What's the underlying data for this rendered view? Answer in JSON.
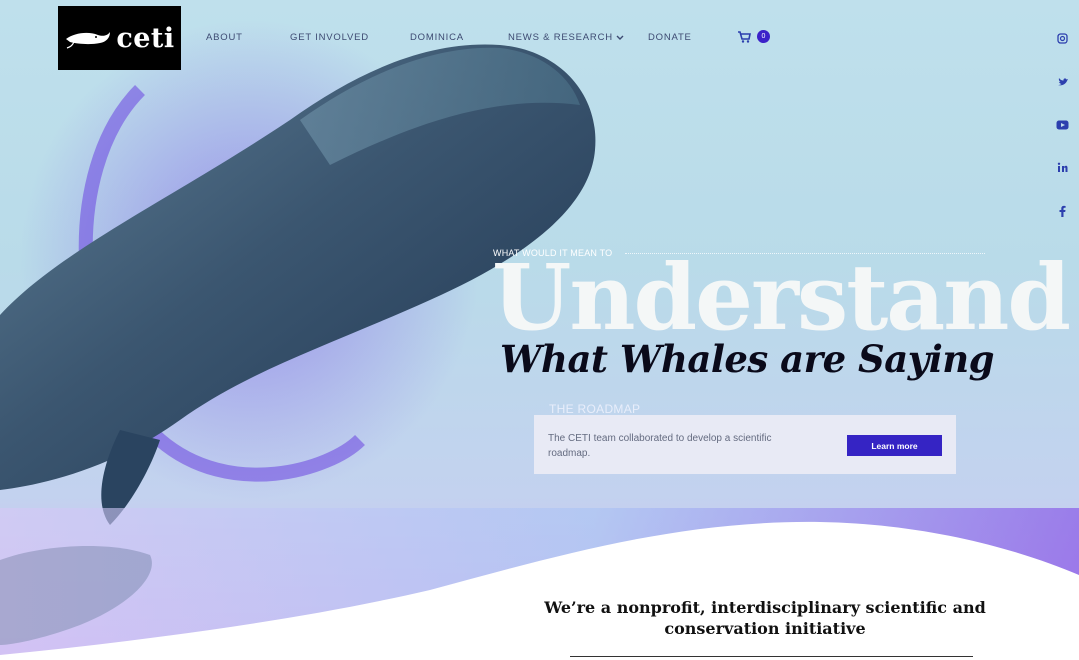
{
  "brand": {
    "logo_text": "ceti"
  },
  "nav": {
    "items": [
      {
        "label": "ABOUT"
      },
      {
        "label": "GET INVOLVED"
      },
      {
        "label": "DOMINICA"
      },
      {
        "label": "NEWS & RESEARCH"
      },
      {
        "label": "DONATE"
      }
    ],
    "cart_count": "0"
  },
  "social": [
    "instagram-icon",
    "twitter-icon",
    "youtube-icon",
    "linkedin-icon",
    "facebook-icon"
  ],
  "hero": {
    "eyebrow": "WHAT WOULD IT MEAN TO",
    "headline": "Understand",
    "subhead": "What Whales are Saying"
  },
  "roadmap": {
    "title": "THE ROADMAP",
    "text": "The CETI team collaborated to develop a scientific roadmap.",
    "button": "Learn more"
  },
  "mission": "We’re a nonprofit, interdisciplinary scientific and conservation initiative",
  "colors": {
    "accent": "#3524c4",
    "sky": "#bfe0ec",
    "violet": "#8f4fe8"
  }
}
